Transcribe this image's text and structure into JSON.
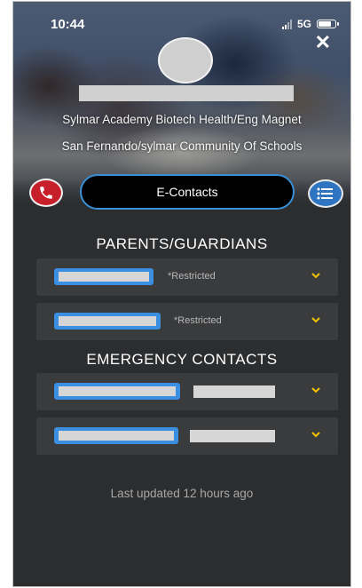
{
  "status_bar": {
    "time": "10:44",
    "network": "5G"
  },
  "header": {
    "school_name": "Sylmar Academy Biotech Health/Eng Magnet",
    "community": "San Fernando/sylmar Community Of Schools"
  },
  "actions": {
    "econtacts_label": "E-Contacts"
  },
  "parents": {
    "title": "PARENTS/GUARDIANS",
    "items": [
      {
        "status": "*Restricted"
      },
      {
        "status": "*Restricted"
      }
    ]
  },
  "emergency": {
    "title": "EMERGENCY CONTACTS"
  },
  "footer": {
    "updated_text": "Last updated 12 hours ago"
  },
  "colors": {
    "background": "#2c2d2f",
    "row": "#3a3b3d",
    "accent_blue": "#3a8fe0",
    "chevron": "#f2c500",
    "phone_red": "#c8202a"
  },
  "icons": [
    "close-icon",
    "phone-icon",
    "list-menu-icon",
    "chevron-down-icon",
    "signal-icon",
    "battery-icon"
  ]
}
